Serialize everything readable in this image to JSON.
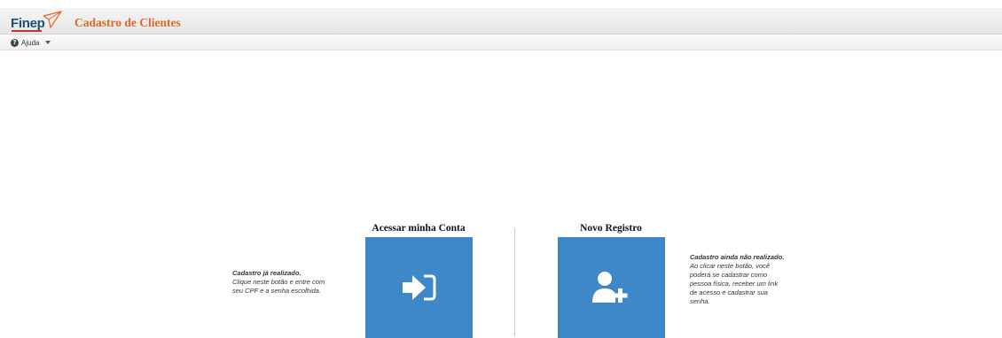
{
  "header": {
    "logo_text": "Finep",
    "title": "Cadastro de Clientes"
  },
  "menu": {
    "help_label": "Ajuda",
    "help_icon": "question-circle-icon"
  },
  "login": {
    "title": "Acessar minha Conta",
    "icon": "sign-in-icon",
    "note_heading": "Cadastro já realizado.",
    "note_lines": [
      "Clique neste botão e entre com",
      "seu CPF e a senha escolhida."
    ]
  },
  "register": {
    "title": "Novo Registro",
    "icon": "user-plus-icon",
    "note_heading": "Cadastro ainda não realizado.",
    "note_lines": [
      "Ao clicar neste botão, você",
      "poderá se cadastrar como",
      "pessoa física, receber um link",
      "de acesso e cadastrar sua",
      "senha."
    ]
  },
  "colors": {
    "tile": "#3e87c9",
    "title": "#e0672a",
    "logo": "#1f4e79"
  }
}
